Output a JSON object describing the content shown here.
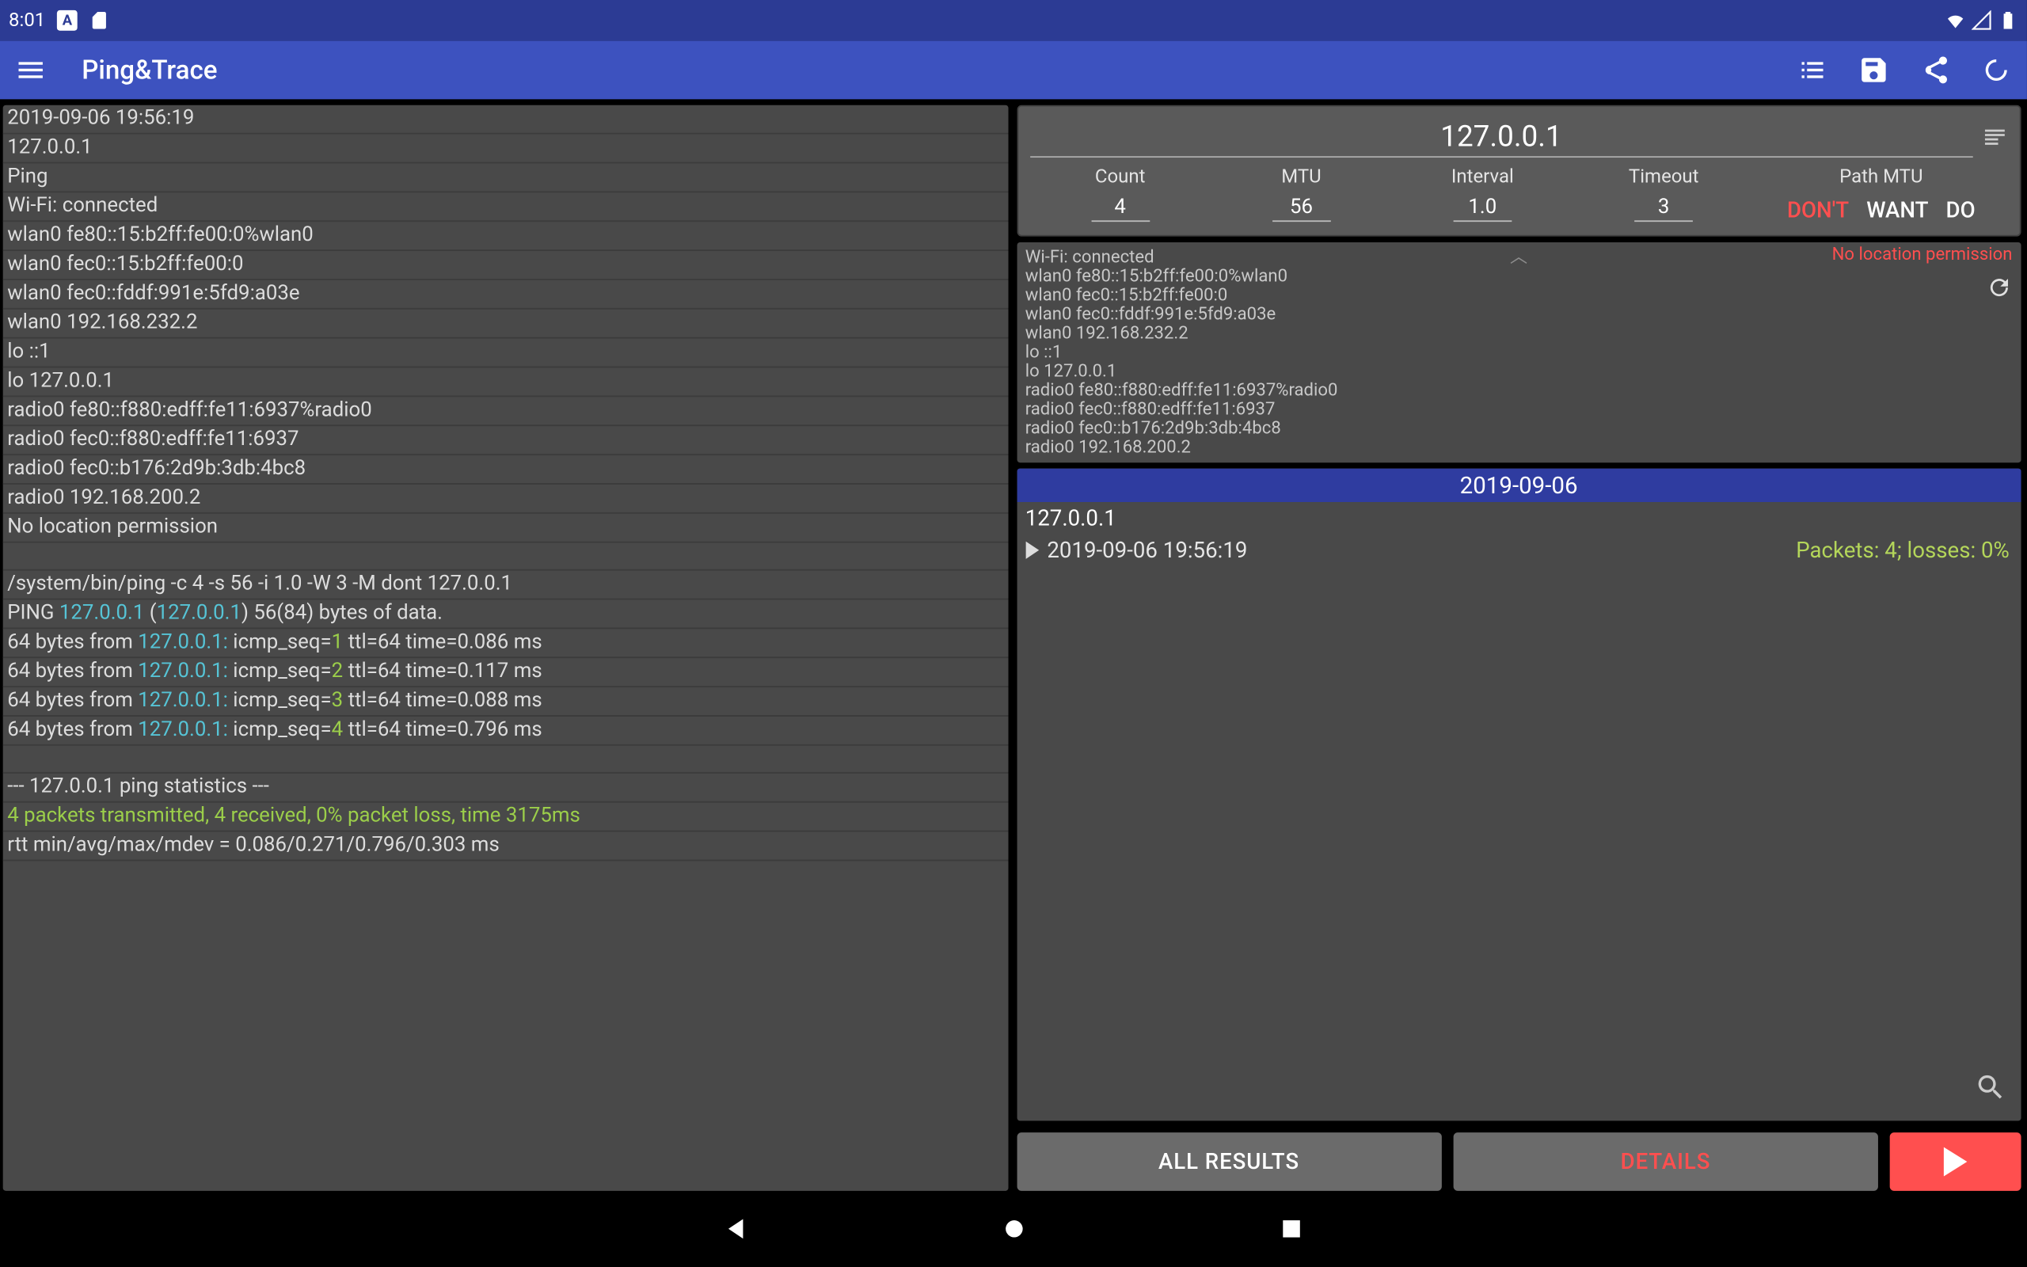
{
  "status_bar": {
    "time": "8:01"
  },
  "app": {
    "title": "Ping&Trace"
  },
  "target": {
    "host": "127.0.0.1"
  },
  "params": {
    "count": {
      "label": "Count",
      "value": "4"
    },
    "mtu": {
      "label": "MTU",
      "value": "56"
    },
    "interval": {
      "label": "Interval",
      "value": "1.0"
    },
    "timeout": {
      "label": "Timeout",
      "value": "3"
    },
    "pathmtu": {
      "label": "Path MTU",
      "dont": "DON'T",
      "want": "WANT",
      "do": "DO",
      "selected": "DON'T"
    }
  },
  "netinfo": {
    "no_location_label": "No location permission",
    "lines": [
      "Wi-Fi: connected",
      "wlan0 fe80::15:b2ff:fe00:0%wlan0",
      "wlan0 fec0::15:b2ff:fe00:0",
      "wlan0 fec0::fddf:991e:5fd9:a03e",
      "wlan0 192.168.232.2",
      "lo ::1",
      "lo 127.0.0.1",
      "radio0 fe80::f880:edff:fe11:6937%radio0",
      "radio0 fec0::f880:edff:fe11:6937",
      "radio0 fec0::b176:2d9b:3db:4bc8",
      "radio0 192.168.200.2"
    ]
  },
  "history": {
    "date": "2019-09-06",
    "ip": "127.0.0.1",
    "entry_time": "2019-09-06 19:56:19",
    "entry_stats": "Packets: 4; losses: 0%"
  },
  "buttons": {
    "all_results": "ALL RESULTS",
    "details": "DETAILS"
  },
  "log": {
    "header_time": "2019-09-06 19:56:19",
    "header_ip": "127.0.0.1",
    "header_mode": "Ping",
    "wifi": "Wi-Fi: connected",
    "if0": "wlan0 fe80::15:b2ff:fe00:0%wlan0",
    "if1": "wlan0 fec0::15:b2ff:fe00:0",
    "if2": "wlan0 fec0::fddf:991e:5fd9:a03e",
    "if3": "wlan0 192.168.232.2",
    "if4": "lo ::1",
    "if5": "lo 127.0.0.1",
    "if6": "radio0 fe80::f880:edff:fe11:6937%radio0",
    "if7": "radio0 fec0::f880:edff:fe11:6937",
    "if8": "radio0 fec0::b176:2d9b:3db:4bc8",
    "if9": "radio0 192.168.200.2",
    "noloc": "No location permission",
    "cmd": "/system/bin/ping  -c 4 -s 56 -i 1.0 -W 3 -M dont 127.0.0.1",
    "ping_pre": "PING ",
    "ping_host": "127.0.0.1",
    "ping_mid": " (",
    "ping_ip": "127.0.0.1",
    "ping_post": ") 56(84) bytes of data.",
    "reply_pre": "64 bytes from ",
    "reply_host": "127.0.0.1:",
    "reply_seq_lbl": " icmp_seq=",
    "r1_seq": "1",
    "r1_tail": " ttl=64 time=0.086 ms",
    "r2_seq": "2",
    "r2_tail": " ttl=64 time=0.117 ms",
    "r3_seq": "3",
    "r3_tail": " ttl=64 time=0.088 ms",
    "r4_seq": "4",
    "r4_tail": " ttl=64 time=0.796 ms",
    "stats_hdr": "--- 127.0.0.1 ping statistics ---",
    "stats_green": "4 packets transmitted, 4 received, 0% packet loss, time 3175ms",
    "stats_rtt": "rtt min/avg/max/mdev = 0.086/0.271/0.796/0.303 ms"
  }
}
